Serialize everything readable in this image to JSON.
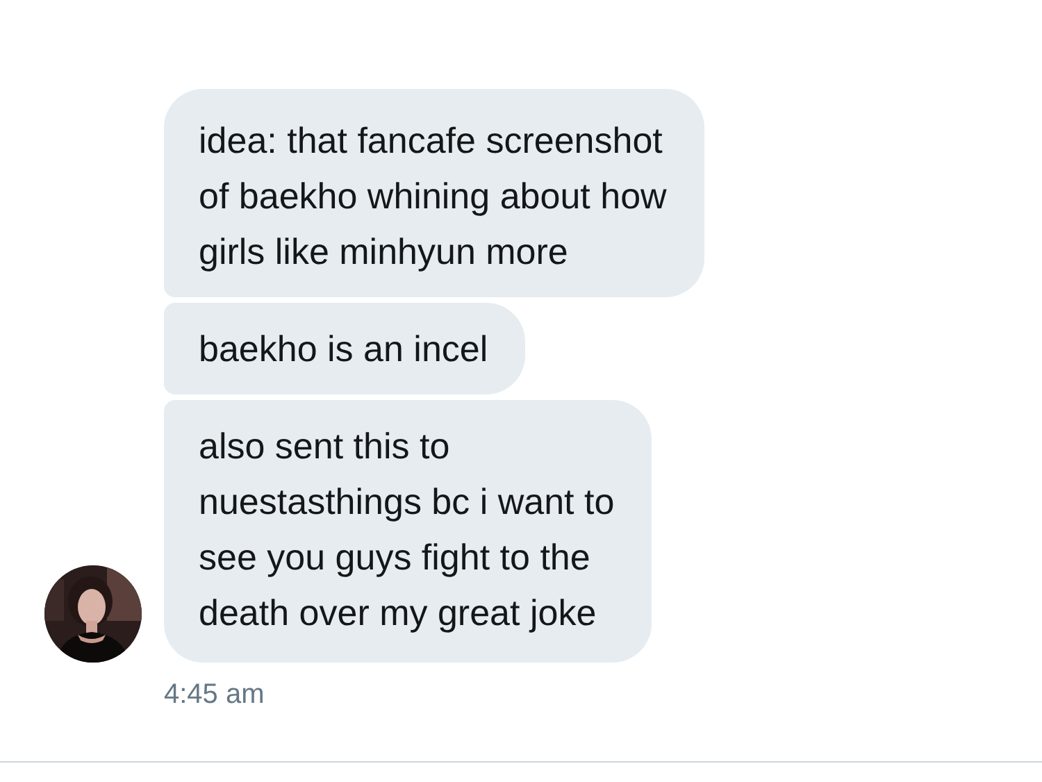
{
  "messages": [
    {
      "lines": [
        "idea: that fancafe screenshot",
        "of baekho whining about how",
        "girls like minhyun more"
      ]
    },
    {
      "lines": [
        "baekho is an incel"
      ]
    },
    {
      "lines": [
        "also sent this to",
        "nuestasthings bc i want to",
        "see you guys fight to the",
        "death over my great joke"
      ]
    }
  ],
  "timestamp": "4:45 am"
}
